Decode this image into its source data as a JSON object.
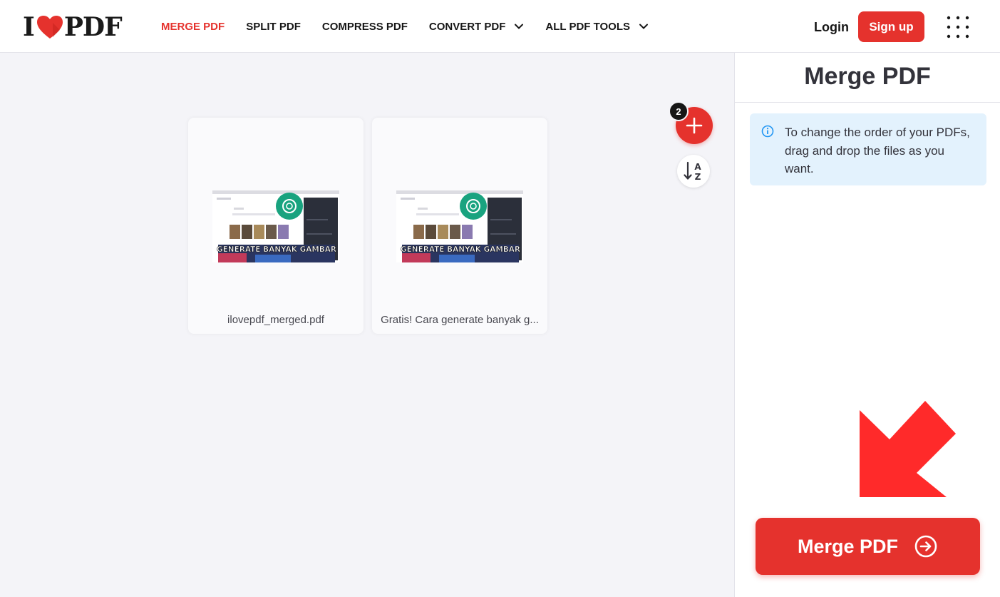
{
  "colors": {
    "brand": "#e5322d",
    "text": "#33333b",
    "info_bg": "#e3f2fd",
    "info_icon": "#2196f3"
  },
  "header": {
    "logo_left": "I",
    "logo_right": "PDF",
    "nav": [
      {
        "label": "MERGE PDF",
        "active": true
      },
      {
        "label": "SPLIT PDF"
      },
      {
        "label": "COMPRESS PDF"
      },
      {
        "label": "CONVERT PDF",
        "has_dropdown": true
      },
      {
        "label": "ALL PDF TOOLS",
        "has_dropdown": true
      }
    ],
    "login_label": "Login",
    "signup_label": "Sign up",
    "apps_icon": "grid-icon"
  },
  "workspace": {
    "file_count": "2",
    "add_icon": "plus-icon",
    "sort_icon": "sort-az-icon",
    "files": [
      {
        "name": "ilovepdf_merged.pdf",
        "thumb_caption": "GENERATE BANYAK GAMBAR"
      },
      {
        "name": "Gratis! Cara generate banyak g...",
        "thumb_caption": "GENERATE BANYAK GAMBAR"
      }
    ]
  },
  "sidebar": {
    "title": "Merge PDF",
    "info_text": "To change the order of your PDFs, drag and drop the files as you want.",
    "merge_button_label": "Merge PDF",
    "merge_button_icon": "arrow-right-circle-icon"
  }
}
